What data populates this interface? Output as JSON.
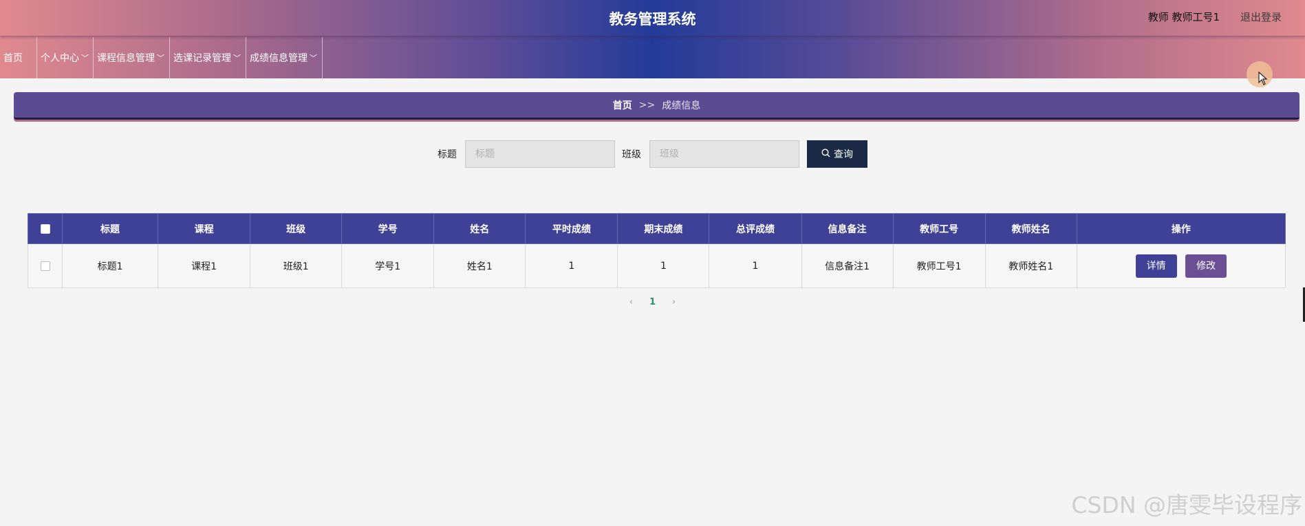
{
  "header": {
    "title": "教务管理系统",
    "user_info": "教师 教师工号1",
    "logout_label": "退出登录"
  },
  "nav": {
    "home": "首页",
    "personal_center": "个人中心",
    "course_info": "课程信息管理",
    "selection_records": "选课记录管理",
    "grade_info": "成绩信息管理",
    "dropdown_glyph": "﹀"
  },
  "breadcrumb": {
    "home": "首页",
    "separator": ">>",
    "current": "成绩信息"
  },
  "search": {
    "title_label": "标题",
    "title_placeholder": "标题",
    "class_label": "班级",
    "class_placeholder": "班级",
    "query_label": "查询",
    "query_icon": "search-icon"
  },
  "table": {
    "columns": [
      "标题",
      "课程",
      "班级",
      "学号",
      "姓名",
      "平时成绩",
      "期末成绩",
      "总评成绩",
      "信息备注",
      "教师工号",
      "教师姓名",
      "操作"
    ],
    "rows": [
      {
        "title": "标题1",
        "course": "课程1",
        "class": "班级1",
        "student_id": "学号1",
        "name": "姓名1",
        "regular_score": "1",
        "final_score": "1",
        "overall_score": "1",
        "remark": "信息备注1",
        "teacher_id": "教师工号1",
        "teacher_name": "教师姓名1",
        "detail_label": "详情",
        "edit_label": "修改"
      }
    ]
  },
  "pagination": {
    "prev": "‹",
    "current_page": "1",
    "next": "›"
  },
  "watermark": "CSDN @唐雯毕设程序",
  "colors": {
    "table_header": "#3e4195",
    "query_button": "#1b2a44",
    "detail_button": "#3e4195",
    "edit_button": "#6a4f95",
    "breadcrumb_bg": "#5a4c92"
  }
}
